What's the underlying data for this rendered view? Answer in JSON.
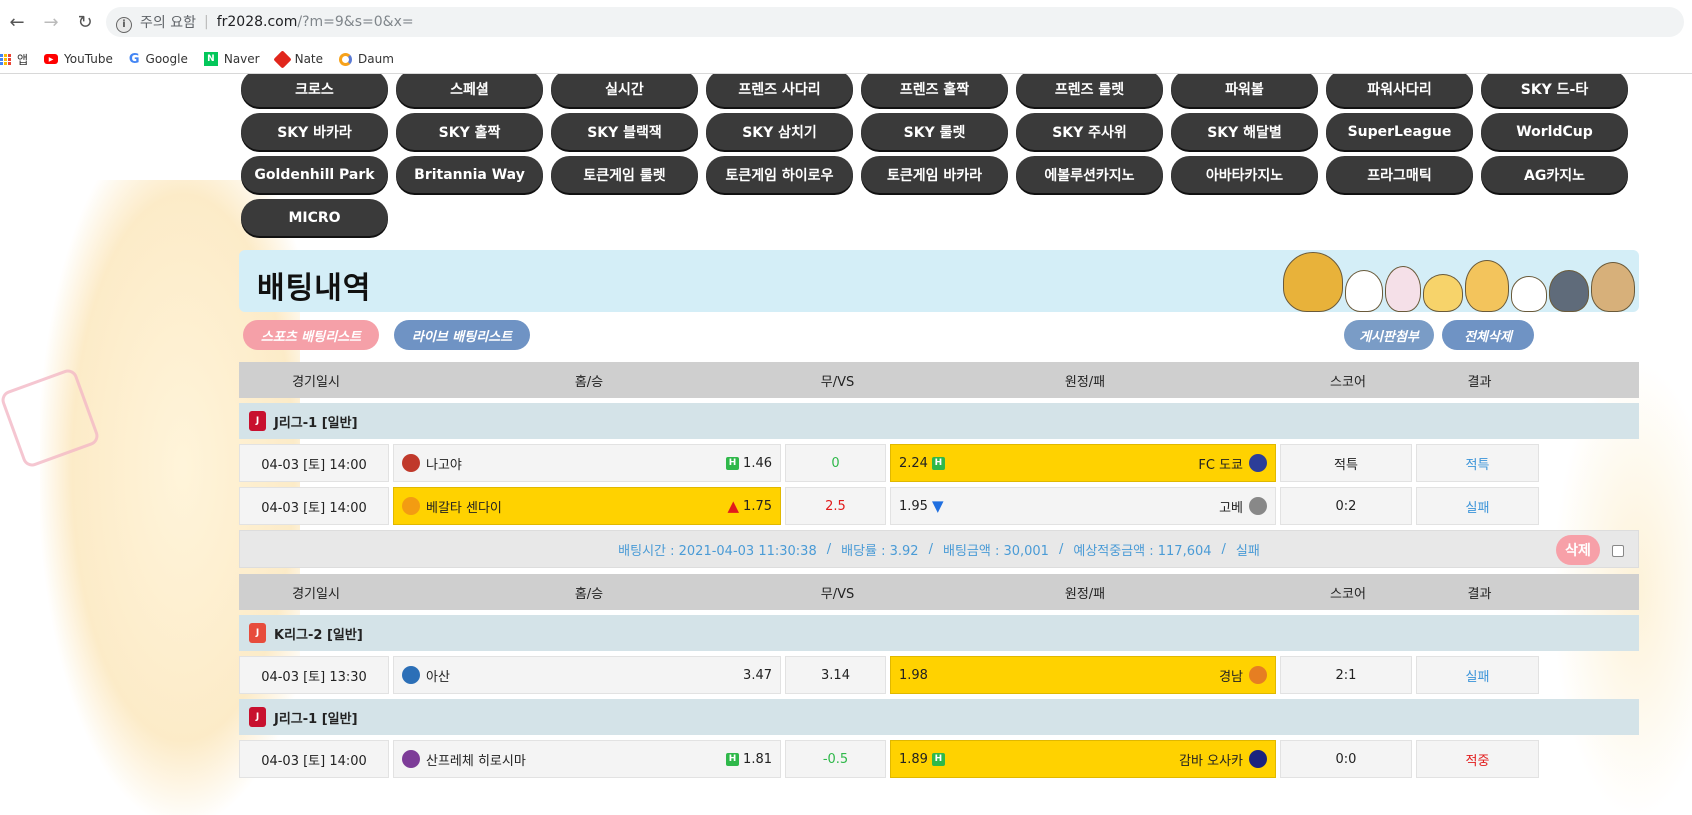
{
  "browser": {
    "security_label": "주의 요함",
    "url_domain": "fr2028.com",
    "url_path": "/?m=9&s=0&x=",
    "bookmarks": [
      {
        "label": "앱",
        "icon": "apps-grid-icon"
      },
      {
        "label": "YouTube",
        "icon": "youtube-icon"
      },
      {
        "label": "Google",
        "icon": "google-icon"
      },
      {
        "label": "Naver",
        "icon": "naver-icon"
      },
      {
        "label": "Nate",
        "icon": "nate-icon"
      },
      {
        "label": "Daum",
        "icon": "daum-icon"
      }
    ]
  },
  "games": [
    "크로스",
    "스페셜",
    "실시간",
    "프렌즈 사다리",
    "프렌즈 홀짝",
    "프렌즈 룰렛",
    "파워볼",
    "파워사다리",
    "SKY 드-타",
    "SKY 바카라",
    "SKY 홀짝",
    "SKY 블랙잭",
    "SKY 삼치기",
    "SKY 룰렛",
    "SKY 주사위",
    "SKY 해달별",
    "SuperLeague",
    "WorldCup",
    "Goldenhill Park",
    "Britannia Way",
    "토큰게임 룰렛",
    "토큰게임 하이로우",
    "토큰게임 바카라",
    "에볼루션카지노",
    "아바타카지노",
    "프라그매틱",
    "AG카지노",
    "MICRO"
  ],
  "banner": {
    "title": "배팅내역"
  },
  "actions": {
    "sports_list": "스포츠 배팅리스트",
    "live_list": "라이브 배팅리스트",
    "board_attach": "게시판첨부",
    "delete_all": "전체삭제"
  },
  "columns": [
    "경기일시",
    "홈/승",
    "무/VS",
    "원정/패",
    "스코어",
    "결과"
  ],
  "slips": [
    {
      "groups": [
        {
          "league": "J리그-1 [일반]",
          "league_color": "#c8102e",
          "matches": [
            {
              "time": "04-03 [토] 14:00",
              "home": "나고야",
              "home_odds": "1.46",
              "home_badge": "H",
              "home_sel": false,
              "home_arrow": "",
              "draw": "0",
              "draw_color": "green",
              "away_odds": "2.24",
              "away_badge": "H",
              "away_arrow": "",
              "away": "FC 도쿄",
              "away_sel": true,
              "score": "적특",
              "result": "적특",
              "result_color": "blue",
              "home_logo": "#c0392b",
              "away_logo": "#2c3e99"
            },
            {
              "time": "04-03 [토] 14:00",
              "home": "베갈타 센다이",
              "home_odds": "1.75",
              "home_badge": "",
              "home_sel": true,
              "home_arrow": "up",
              "draw": "2.5",
              "draw_color": "red",
              "away_odds": "1.95",
              "away_badge": "",
              "away_arrow": "down",
              "away": "고베",
              "away_sel": false,
              "score": "0:2",
              "result": "실패",
              "result_color": "blue",
              "home_logo": "#f39c12",
              "away_logo": "#888888"
            }
          ]
        }
      ],
      "summary": {
        "bet_time": "배팅시간 : 2021-04-03 11:30:38",
        "odds": "배당률 : 3.92",
        "amount": "배팅금액 : 30,001",
        "expected": "예상적중금액 : 117,604",
        "status": "실패",
        "delete_label": "삭제"
      }
    },
    {
      "groups": [
        {
          "league": "K리그-2 [일반]",
          "league_color": "#e74c3c",
          "matches": [
            {
              "time": "04-03 [토] 13:30",
              "home": "아산",
              "home_odds": "3.47",
              "home_badge": "",
              "home_sel": false,
              "home_arrow": "",
              "draw": "3.14",
              "draw_color": "",
              "away_odds": "1.98",
              "away_badge": "",
              "away_arrow": "",
              "away": "경남",
              "away_sel": true,
              "score": "2:1",
              "result": "실패",
              "result_color": "blue",
              "home_logo": "#2c6fb7",
              "away_logo": "#e67e22"
            }
          ]
        },
        {
          "league": "J리그-1 [일반]",
          "league_color": "#c8102e",
          "matches": [
            {
              "time": "04-03 [토] 14:00",
              "home": "산프레체 히로시마",
              "home_odds": "1.81",
              "home_badge": "H",
              "home_sel": false,
              "home_arrow": "",
              "draw": "-0.5",
              "draw_color": "green",
              "away_odds": "1.89",
              "away_badge": "H",
              "away_arrow": "",
              "away": "감바 오사카",
              "away_sel": true,
              "score": "0:0",
              "result": "적중",
              "result_color": "red",
              "home_logo": "#7d3c98",
              "away_logo": "#1a237e"
            }
          ]
        }
      ]
    }
  ]
}
